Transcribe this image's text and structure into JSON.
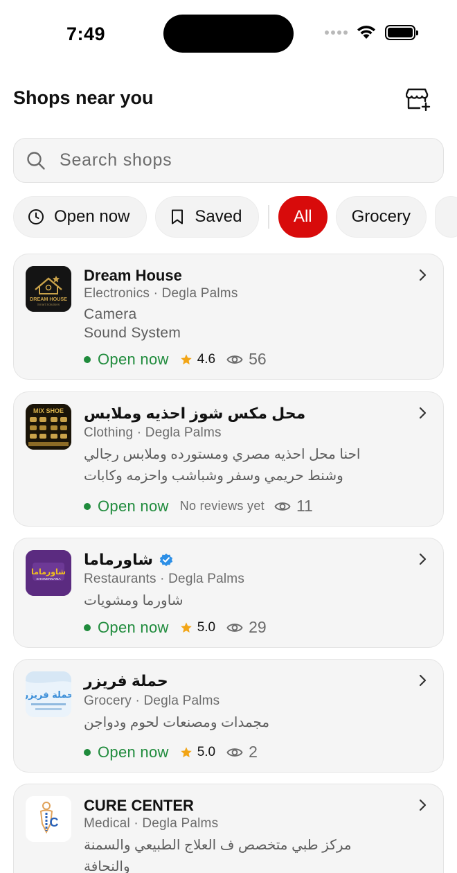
{
  "status_bar": {
    "time": "7:49"
  },
  "header": {
    "title": "Shops near you",
    "add_icon": "store-add-icon"
  },
  "search": {
    "placeholder": "Search shops",
    "value": ""
  },
  "filters": {
    "open_now": "Open now",
    "saved": "Saved",
    "categories": [
      "All",
      "Grocery"
    ],
    "selected": "All"
  },
  "colors": {
    "accent": "#d80b0b",
    "open": "#1f8b3c",
    "star": "#f2a516",
    "verified": "#2d8fe6"
  },
  "shops": [
    {
      "name": "Dream House",
      "meta": "Electronics · Degla Palms",
      "desc": [
        "Camera",
        "Sound System"
      ],
      "status": "Open now",
      "rating": "4.6",
      "views": "56",
      "logo_text": [
        "DREAM HOUSE",
        "Smart Solutions"
      ]
    },
    {
      "name": "محل مكس شوز احذيه وملابس",
      "meta": "Clothing · Degla Palms",
      "desc": [
        "احنا محل احذيه مصري ومستورده وملابس رجالي",
        "وشنط حريمي وسفر وشباشب واحزمه وكابات"
      ],
      "status": "Open now",
      "rating_text": "No reviews yet",
      "views": "11",
      "logo_text": [
        "MIX SHOE"
      ]
    },
    {
      "name": "شاورماما",
      "verified": true,
      "meta": "Restaurants · Degla Palms",
      "desc": [
        "شاورما ومشويات"
      ],
      "status": "Open now",
      "rating": "5.0",
      "views": "29",
      "logo_text": [
        "شاورماما",
        "SHAWERMAMA"
      ]
    },
    {
      "name": "حملة فريزر",
      "meta": "Grocery · Degla Palms",
      "desc": [
        "مجمدات ومصنعات لحوم ودواجن"
      ],
      "status": "Open now",
      "rating": "5.0",
      "views": "2",
      "logo_text": [
        "حملة فريزر"
      ]
    },
    {
      "name": "CURE CENTER",
      "meta": "Medical · Degla Palms",
      "desc": [
        "مركز طبي متخصص ف العلاج الطبيعي والسمنة",
        "والنحافة"
      ],
      "logo_text": [
        "C"
      ]
    }
  ]
}
